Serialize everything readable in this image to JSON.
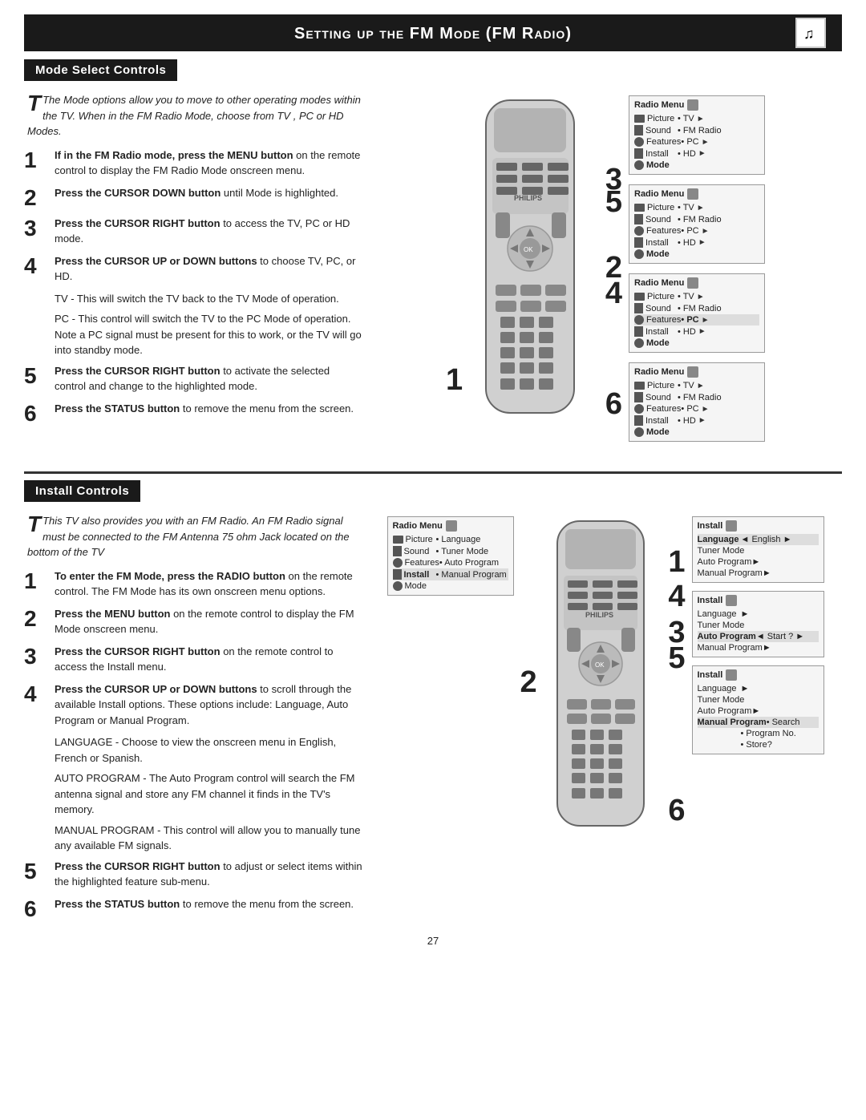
{
  "page": {
    "title": "Setting up the FM Mode (FM Radio)",
    "page_number": "27"
  },
  "section1": {
    "header": "Mode Select Controls",
    "intro": "The Mode options allow you to move to other operating modes within the TV. When in the FM Radio Mode, choose from TV , PC or HD Modes.",
    "steps": [
      {
        "num": "1",
        "bold_text": "If in the FM Radio mode, press the MENU button",
        "text": " on the remote control to display the FM Radio Mode onscreen menu."
      },
      {
        "num": "2",
        "bold_text": "Press the CURSOR DOWN button",
        "text": " until Mode is highlighted."
      },
      {
        "num": "3",
        "bold_text": "Press the CURSOR RIGHT button",
        "text": " to access the TV, PC or HD mode."
      },
      {
        "num": "4",
        "bold_text": "Press the CURSOR UP or DOWN buttons",
        "text": " to choose TV, PC, or HD."
      },
      {
        "num": "5",
        "bold_text": "Press the CURSOR RIGHT button",
        "text": " to activate the selected control and change to the highlighted mode."
      },
      {
        "num": "6",
        "bold_text": "Press the STATUS button",
        "text": " to remove the menu from the screen."
      }
    ],
    "paras": [
      "TV - This will switch the TV back to the TV Mode of operation.",
      "PC - This control will switch the TV to the PC Mode of operation. Note a PC signal must be present for this to work, or the TV will go into standby mode."
    ],
    "menus": [
      {
        "title": "Radio Menu",
        "rows": [
          {
            "label": "Picture",
            "value": "• TV",
            "arrow": true,
            "bold_label": false
          },
          {
            "label": "Sound",
            "value": "• FM Radio",
            "arrow": false,
            "bold_label": false
          },
          {
            "label": "Features",
            "value": "• PC",
            "arrow": true,
            "bold_label": false
          },
          {
            "label": "Install",
            "value": "• HD",
            "arrow": true,
            "bold_label": false
          },
          {
            "label": "Mode",
            "value": "",
            "arrow": false,
            "bold_label": true
          }
        ]
      },
      {
        "title": "Radio Menu",
        "rows": [
          {
            "label": "Picture",
            "value": "• TV",
            "arrow": true,
            "bold_label": false
          },
          {
            "label": "Sound",
            "value": "• FM Radio",
            "arrow": false,
            "bold_label": false
          },
          {
            "label": "Features",
            "value": "• PC",
            "arrow": true,
            "bold_label": false
          },
          {
            "label": "Install",
            "value": "• HD",
            "arrow": true,
            "bold_label": false
          },
          {
            "label": "Mode",
            "value": "",
            "arrow": false,
            "bold_label": true
          }
        ]
      },
      {
        "title": "Radio Menu",
        "rows": [
          {
            "label": "Picture",
            "value": "• TV",
            "arrow": true,
            "bold_label": false
          },
          {
            "label": "Sound",
            "value": "• FM Radio",
            "arrow": false,
            "bold_label": false
          },
          {
            "label": "Features",
            "value": "• PC",
            "arrow": true,
            "bold_label": false,
            "highlight": true
          },
          {
            "label": "Install",
            "value": "• HD",
            "arrow": true,
            "bold_label": false
          },
          {
            "label": "Mode",
            "value": "",
            "arrow": false,
            "bold_label": true
          }
        ]
      },
      {
        "title": "Radio Menu",
        "rows": [
          {
            "label": "Picture",
            "value": "• TV",
            "arrow": true,
            "bold_label": false
          },
          {
            "label": "Sound",
            "value": "• FM Radio",
            "arrow": false,
            "bold_label": false
          },
          {
            "label": "Features",
            "value": "• PC",
            "arrow": true,
            "bold_label": false
          },
          {
            "label": "Install",
            "value": "• HD",
            "arrow": true,
            "bold_label": false
          },
          {
            "label": "Mode",
            "value": "",
            "arrow": false,
            "bold_label": true
          }
        ]
      }
    ]
  },
  "section2": {
    "header": "Install Controls",
    "intro": "This TV also provides you with an FM Radio. An FM Radio signal must be connected to the FM Antenna 75 ohm Jack located on the bottom of the TV",
    "steps": [
      {
        "num": "1",
        "bold_text": "To enter the FM Mode, press the RADIO button",
        "text": " on the remote control. The FM Mode has its own onscreen menu options."
      },
      {
        "num": "2",
        "bold_text": "Press the MENU button",
        "text": " on the remote control to display the FM Mode onscreen menu."
      },
      {
        "num": "3",
        "bold_text": "Press the CURSOR RIGHT button",
        "text": " on the remote control to access the Install menu."
      },
      {
        "num": "4",
        "bold_text": "Press the CURSOR UP or DOWN buttons",
        "text": " to scroll through the available Install options. These options include: Language, Auto Program or Manual Program."
      },
      {
        "num": "5",
        "bold_text": "Press the CURSOR RIGHT button",
        "text": " to adjust or select items within the highlighted feature sub-menu."
      },
      {
        "num": "6",
        "bold_text": "Press the STATUS button",
        "text": " to remove the menu from the screen."
      }
    ],
    "paras": [
      "LANGUAGE - Choose to view the onscreen menu in English, French or Spanish.",
      "AUTO PROGRAM - The Auto Program control will search the FM antenna signal and store any FM channel it finds in the TV's memory.",
      "MANUAL PROGRAM - This control will allow you to manually tune any available FM signals."
    ],
    "menu_install_left": {
      "title": "Radio Menu",
      "rows": [
        {
          "label": "Picture",
          "value": "• Language",
          "arrow": false
        },
        {
          "label": "Sound",
          "value": "• Tuner Mode",
          "arrow": false
        },
        {
          "label": "Features",
          "value": "• Auto Program",
          "arrow": false
        },
        {
          "label": "Install",
          "value": "• Manual Program",
          "arrow": false
        },
        {
          "label": "Mode",
          "value": "",
          "arrow": false
        }
      ]
    },
    "menus_right": [
      {
        "title": "Install",
        "rows": [
          {
            "label": "Language",
            "value": "◄ English ►",
            "bold": true
          },
          {
            "label": "Tuner Mode",
            "value": ""
          },
          {
            "label": "Auto Program",
            "value": "►"
          },
          {
            "label": "Manual Program",
            "value": "►"
          }
        ]
      },
      {
        "title": "Install",
        "rows": [
          {
            "label": "Language",
            "value": "►"
          },
          {
            "label": "Tuner Mode",
            "value": ""
          },
          {
            "label": "Auto Program",
            "value": "◄ Start ? ►",
            "bold": true
          },
          {
            "label": "Manual Program",
            "value": "►"
          }
        ]
      },
      {
        "title": "Install",
        "rows": [
          {
            "label": "Language",
            "value": "►"
          },
          {
            "label": "Tuner Mode",
            "value": ""
          },
          {
            "label": "Auto Program",
            "value": "►"
          },
          {
            "label": "Manual Program",
            "value": "• Search"
          }
        ],
        "extra_rows": [
          {
            "label": "",
            "value": "• Program No."
          },
          {
            "label": "",
            "value": "• Store?"
          }
        ]
      }
    ]
  }
}
